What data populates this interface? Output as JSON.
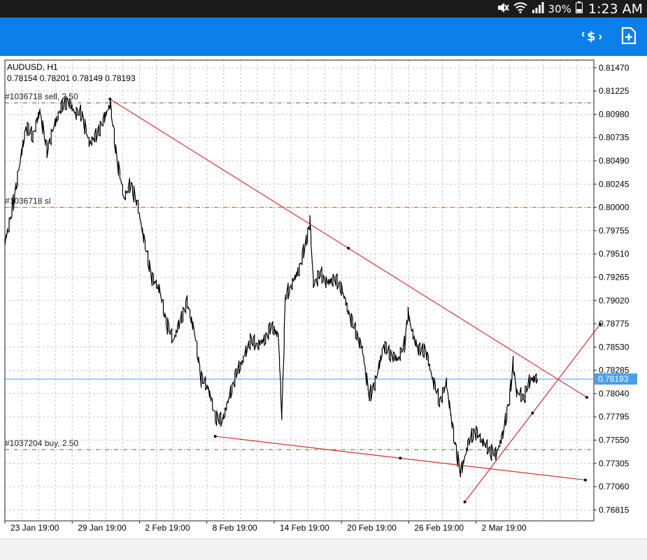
{
  "status_bar": {
    "battery_percent": "30%",
    "time": "1:23 AM",
    "icons": [
      "mute-icon",
      "wifi-icon",
      "signal-icon",
      "battery-icon"
    ]
  },
  "toolbar": {
    "trade_icon": "dollar-trade-icon",
    "new_order_icon": "add-document-icon",
    "color": "#0b7fea"
  },
  "chart": {
    "symbol": "AUDUSD, H1",
    "ohlc": "0.78154 0.78201 0.78149 0.78193",
    "current_price": "0.78193",
    "y_ticks": [
      "0.81470",
      "0.81225",
      "0.80980",
      "0.80735",
      "0.80490",
      "0.80245",
      "0.80000",
      "0.79755",
      "0.79510",
      "0.79265",
      "0.79020",
      "0.78775",
      "0.78530",
      "0.78285",
      "0.78040",
      "0.77795",
      "0.77550",
      "0.77305",
      "0.77060",
      "0.76815"
    ],
    "x_ticks": [
      "23 Jan 19:00",
      "29 Jan 19:00",
      "2 Feb 19:00",
      "8 Feb 19:00",
      "14 Feb 19:00",
      "20 Feb 19:00",
      "26 Feb 19:00",
      "2 Mar 19:00"
    ],
    "order_lines": [
      {
        "label": "#1036718 sell, 2.50",
        "price": 0.811,
        "color": "#2e7d32"
      },
      {
        "label": "#1036718 sl",
        "price": 0.8,
        "color": "#e65100"
      },
      {
        "label": "#1037204 buy, 2.50",
        "price": 0.7745,
        "color": "#2e7d32"
      }
    ],
    "colors": {
      "grid": "#c8c8c8",
      "trendline": "#d32f2f",
      "price_line": "#4a9fe8",
      "price_label_bg": "#4a9fe8",
      "candles": "#000000"
    }
  },
  "chart_data": {
    "type": "line",
    "title": "AUDUSD, H1",
    "xlabel": "",
    "ylabel": "",
    "ylim": [
      0.767,
      0.8155
    ],
    "x_index_range": [
      0,
      840
    ],
    "grid": true,
    "series": [
      {
        "points": [
          [
            0,
            0.7963
          ],
          [
            10,
            0.7995
          ],
          [
            20,
            0.804
          ],
          [
            30,
            0.8085
          ],
          [
            40,
            0.8075
          ],
          [
            50,
            0.8102
          ],
          [
            60,
            0.806
          ],
          [
            70,
            0.8085
          ],
          [
            80,
            0.8105
          ],
          [
            90,
            0.8112
          ],
          [
            100,
            0.81
          ],
          [
            110,
            0.8098
          ],
          [
            120,
            0.8068
          ],
          [
            130,
            0.8075
          ],
          [
            140,
            0.809
          ],
          [
            150,
            0.811
          ],
          [
            160,
            0.805
          ],
          [
            170,
            0.801
          ],
          [
            180,
            0.8025
          ],
          [
            190,
            0.8
          ],
          [
            200,
            0.796
          ],
          [
            210,
            0.7925
          ],
          [
            220,
            0.7915
          ],
          [
            230,
            0.788
          ],
          [
            240,
            0.786
          ],
          [
            250,
            0.788
          ],
          [
            260,
            0.79
          ],
          [
            270,
            0.787
          ],
          [
            280,
            0.782
          ],
          [
            290,
            0.781
          ],
          [
            300,
            0.778
          ],
          [
            310,
            0.7775
          ],
          [
            320,
            0.78
          ],
          [
            330,
            0.7825
          ],
          [
            340,
            0.784
          ],
          [
            350,
            0.786
          ],
          [
            360,
            0.7855
          ],
          [
            370,
            0.786
          ],
          [
            380,
            0.7875
          ],
          [
            390,
            0.7865
          ],
          [
            395,
            0.778
          ],
          [
            400,
            0.7905
          ],
          [
            410,
            0.792
          ],
          [
            420,
            0.7935
          ],
          [
            430,
            0.7965
          ],
          [
            435,
            0.7985
          ],
          [
            440,
            0.792
          ],
          [
            450,
            0.793
          ],
          [
            460,
            0.792
          ],
          [
            470,
            0.7925
          ],
          [
            480,
            0.7915
          ],
          [
            490,
            0.789
          ],
          [
            500,
            0.787
          ],
          [
            510,
            0.785
          ],
          [
            520,
            0.78
          ],
          [
            530,
            0.782
          ],
          [
            540,
            0.7855
          ],
          [
            550,
            0.7845
          ],
          [
            560,
            0.784
          ],
          [
            570,
            0.7855
          ],
          [
            575,
            0.789
          ],
          [
            580,
            0.787
          ],
          [
            590,
            0.785
          ],
          [
            600,
            0.785
          ],
          [
            610,
            0.782
          ],
          [
            620,
            0.7795
          ],
          [
            630,
            0.7815
          ],
          [
            640,
            0.776
          ],
          [
            650,
            0.772
          ],
          [
            660,
            0.775
          ],
          [
            670,
            0.7765
          ],
          [
            680,
            0.7755
          ],
          [
            690,
            0.7745
          ],
          [
            700,
            0.774
          ],
          [
            710,
            0.776
          ],
          [
            720,
            0.78
          ],
          [
            725,
            0.7835
          ],
          [
            730,
            0.7805
          ],
          [
            740,
            0.78
          ],
          [
            750,
            0.782
          ],
          [
            760,
            0.7819
          ]
        ]
      }
    ],
    "horizontal_lines": [
      {
        "label": "#1036718 sell, 2.50",
        "y": 0.811
      },
      {
        "label": "#1036718 sl",
        "y": 0.8
      },
      {
        "label": "#1037204 buy, 2.50",
        "y": 0.7745
      },
      {
        "label": "0.78193",
        "y": 0.78193
      }
    ],
    "trendlines": [
      {
        "from": [
          150,
          0.8114
        ],
        "to": [
          830,
          0.78
        ]
      },
      {
        "from": [
          300,
          0.7759
        ],
        "to": [
          828,
          0.7713
        ]
      },
      {
        "from": [
          656,
          0.769
        ],
        "to": [
          849,
          0.7877
        ]
      }
    ],
    "x_tick_positions": [
      0,
      96,
      192,
      288,
      384,
      480,
      576,
      672
    ]
  }
}
